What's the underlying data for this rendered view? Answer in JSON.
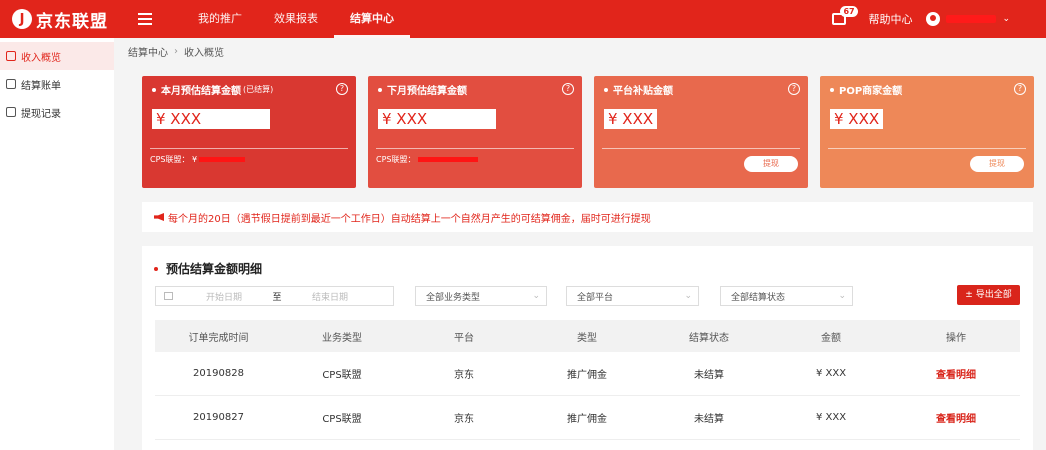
{
  "header": {
    "logo_text": "京东联盟",
    "nav": [
      "我的推广",
      "效果报表",
      "结算中心"
    ],
    "message_count": "67",
    "help": "帮助中心"
  },
  "sidebar": {
    "items": [
      {
        "label": "收入概览"
      },
      {
        "label": "结算账单"
      },
      {
        "label": "提现记录"
      }
    ]
  },
  "breadcrumb": [
    "结算中心",
    "收入概览"
  ],
  "cards": [
    {
      "title": "本月预估结算金额",
      "note": "(已结算)",
      "amount": "¥ XXX",
      "cps": "CPS联盟：  ¥"
    },
    {
      "title": "下月预估结算金额",
      "amount": "¥ XXX",
      "cps": "CPS联盟："
    },
    {
      "title": "平台补贴金额",
      "amount": "¥ XXX",
      "button": "提现"
    },
    {
      "title": "POP商家金额",
      "amount": "¥ XXX",
      "button": "提现"
    }
  ],
  "notice": "每个月的20日（遇节假日提前到最近一个工作日）自动结算上一个自然月产生的可结算佣金，届时可进行提现",
  "detail": {
    "title": "预估结算金额明细",
    "date_start": "开始日期",
    "date_to": "至",
    "date_end": "结束日期",
    "filters": [
      "全部业务类型",
      "全部平台",
      "全部结算状态"
    ],
    "export": "± 导出全部",
    "columns": [
      "订单完成时间",
      "业务类型",
      "平台",
      "类型",
      "结算状态",
      "金额",
      "操作"
    ],
    "rows": [
      [
        "20190828",
        "CPS联盟",
        "京东",
        "推广佣金",
        "未结算",
        "¥ XXX",
        "查看明细"
      ],
      [
        "20190827",
        "CPS联盟",
        "京东",
        "推广佣金",
        "未结算",
        "¥ XXX",
        "查看明细"
      ]
    ]
  }
}
